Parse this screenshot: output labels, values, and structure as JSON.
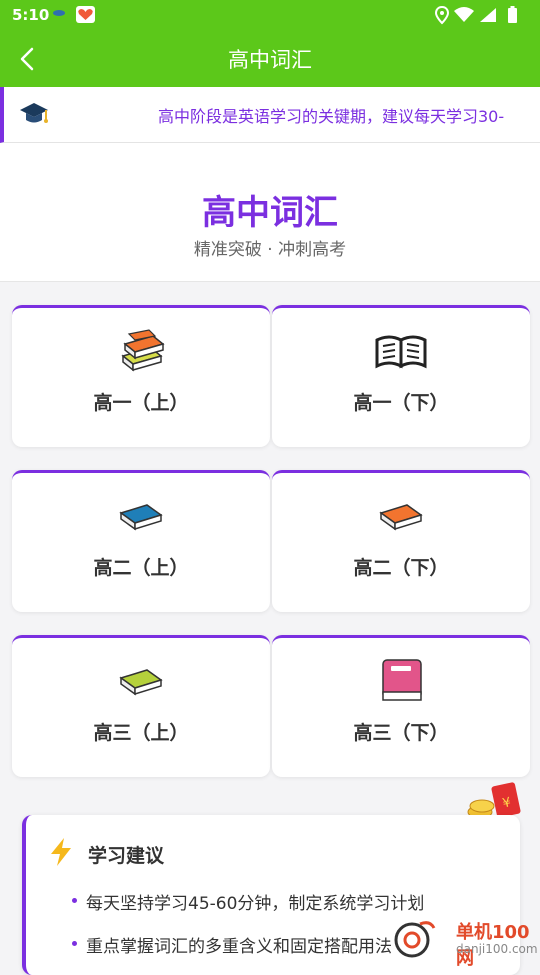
{
  "status_bar": {
    "time": "5:10"
  },
  "header": {
    "title": "高中词汇"
  },
  "notice": {
    "text": "高中阶段是英语学习的关键期，建议每天学习30-"
  },
  "hero": {
    "title": "高中词汇",
    "subtitle": "精准突破 · 冲刺高考"
  },
  "grades": [
    {
      "label": "高一（上）",
      "icon": "book-stack-icon"
    },
    {
      "label": "高一（下）",
      "icon": "open-book-icon"
    },
    {
      "label": "高二（上）",
      "icon": "blue-book-icon"
    },
    {
      "label": "高二（下）",
      "icon": "orange-book-icon"
    },
    {
      "label": "高三（上）",
      "icon": "green-book-icon"
    },
    {
      "label": "高三（下）",
      "icon": "pink-notebook-icon"
    }
  ],
  "tips": {
    "title": "学习建议",
    "items": [
      "每天坚持学习45-60分钟，制定系统学习计划",
      "重点掌握词汇的多重含义和固定搭配用法"
    ]
  },
  "watermark": {
    "name": "单机100网",
    "url": "danji100.com"
  },
  "colors": {
    "green": "#5cc81a",
    "purple": "#7b2fe0"
  }
}
